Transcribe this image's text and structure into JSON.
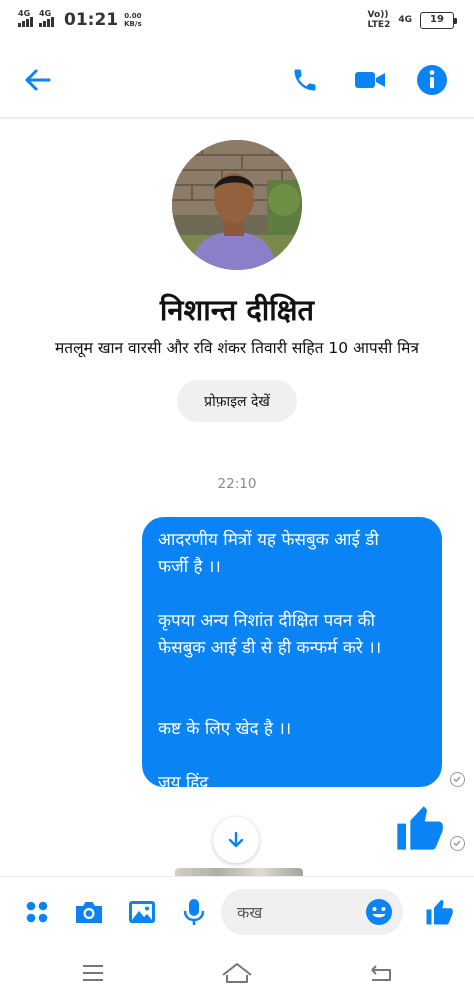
{
  "status_bar": {
    "network1": "4G",
    "network2": "4G",
    "time": "01:21",
    "speed_value": "0.00",
    "speed_unit": "KB/s",
    "volte": "Vo))",
    "lte_label": "LTE2",
    "network3": "4G",
    "battery": "19"
  },
  "header": {
    "back_icon": "arrow-left-icon",
    "call_icon": "phone-icon",
    "video_icon": "video-camera-icon",
    "info_icon": "info-icon",
    "accent_color": "#0a84f5"
  },
  "profile": {
    "name": "निशान्त दीक्षित",
    "mutual_friends": "मतलूम खान वारसी और रवि शंकर तिवारी सहित 10 आपसी मित्र",
    "view_profile_label": "प्रोफ़ाइल देखें"
  },
  "conversation": {
    "timestamp": "22:10",
    "message_lines": [
      "आदरणीय मित्रों यह फेसबुक आई डी",
      "फर्जी है ।।",
      "",
      "कृपया अन्य निशांत दीक्षित पवन की",
      "फेसबुक आई डी से ही कन्फर्म करे ।।",
      "",
      "",
      "कष्ट के लिए खेद है ।।",
      "",
      "जय हिंद"
    ],
    "bubble_color": "#0a84f5"
  },
  "composer": {
    "placeholder": "कख",
    "icons": [
      "apps-dots-icon",
      "camera-icon",
      "image-icon",
      "microphone-icon",
      "emoji-icon",
      "thumbs-up-icon"
    ]
  }
}
